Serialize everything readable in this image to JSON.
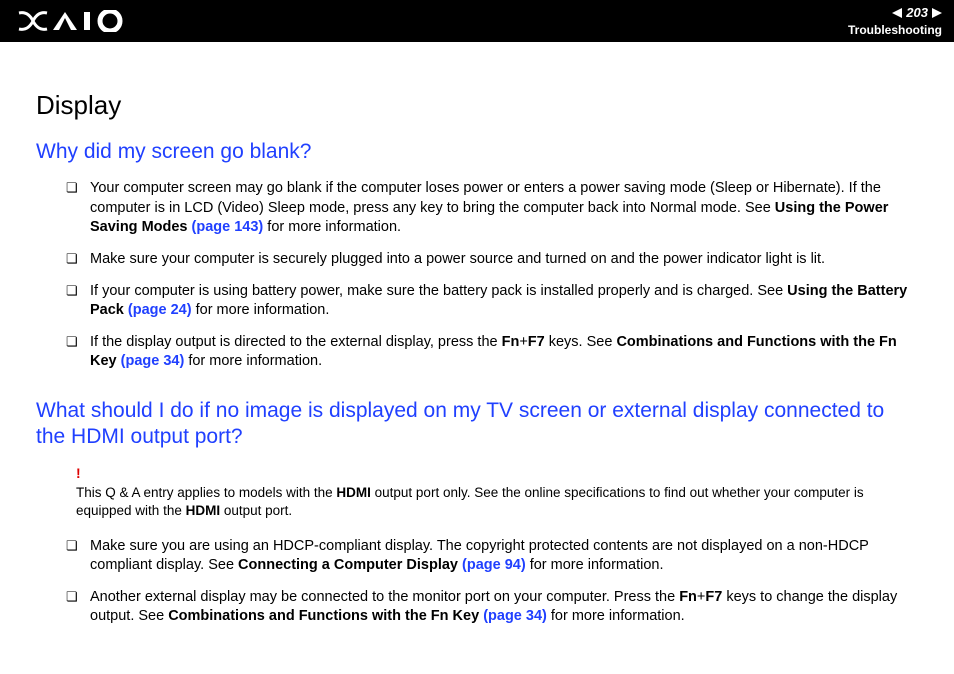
{
  "header": {
    "page_number": "203",
    "section": "Troubleshooting"
  },
  "title": "Display",
  "q1": {
    "heading": "Why did my screen go blank?",
    "items": [
      {
        "pre": "Your computer screen may go blank if the computer loses power or enters a power saving mode (Sleep or Hibernate). If the computer is in LCD (Video) Sleep mode, press any key to bring the computer back into Normal mode. See ",
        "bold": "Using the Power Saving Modes ",
        "link": "(page 143)",
        "post": " for more information."
      },
      {
        "pre": "Make sure your computer is securely plugged into a power source and turned on and the power indicator light is lit.",
        "bold": "",
        "link": "",
        "post": ""
      },
      {
        "pre": "If your computer is using battery power, make sure the battery pack is installed properly and is charged. See ",
        "bold": "Using the Battery Pack ",
        "link": "(page 24)",
        "post": " for more information."
      },
      {
        "pre": "If the display output is directed to the external display, press the ",
        "bold1": "Fn",
        "plus": "+",
        "bold2": "F7",
        "mid": " keys. See ",
        "bold3": "Combinations and Functions with the Fn Key ",
        "link": "(page 34)",
        "post": " for more information."
      }
    ]
  },
  "q2": {
    "heading": "What should I do if no image is displayed on my TV screen or external display connected to the HDMI output port?",
    "note": {
      "excl": "!",
      "pre": "This Q & A entry applies to models with the ",
      "bold1": "HDMI",
      "mid": " output port only. See the online specifications to find out whether your computer is equipped with the ",
      "bold2": "HDMI",
      "post": " output port."
    },
    "items": [
      {
        "pre": "Make sure you are using an HDCP-compliant display. The copyright protected contents are not displayed on a non-HDCP compliant display. See ",
        "bold": "Connecting a Computer Display ",
        "link": "(page 94)",
        "post": " for more information."
      },
      {
        "pre": "Another external display may be connected to the monitor port on your computer. Press the ",
        "bold1": "Fn",
        "plus": "+",
        "bold2": "F7",
        "mid": " keys to change the display output. See ",
        "bold3": "Combinations and Functions with the Fn Key ",
        "link": "(page 34)",
        "post": " for more information."
      }
    ]
  }
}
